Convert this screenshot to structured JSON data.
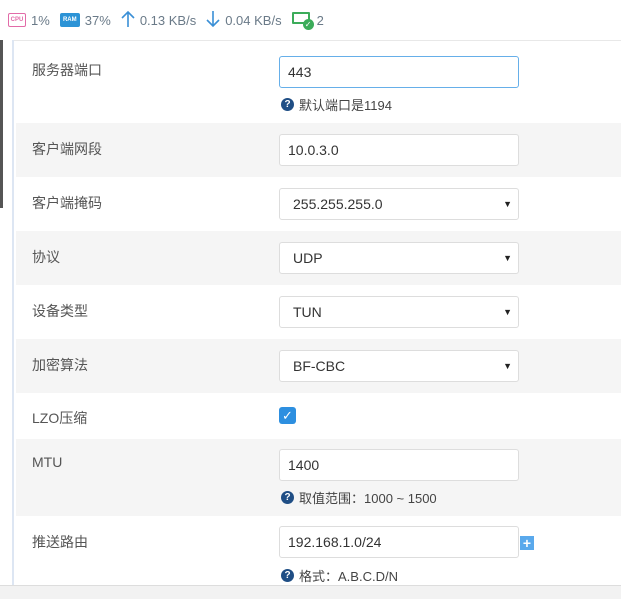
{
  "status": {
    "cpu_icon": "CPU",
    "cpu": "1%",
    "ram_icon": "RAM",
    "ram": "37%",
    "up_icon": "arrow-up-icon",
    "upload": "0.13 KB/s",
    "down_icon": "arrow-down-icon",
    "download": "0.04 KB/s",
    "devices": "2"
  },
  "form": {
    "server_port": {
      "label": "服务器端口",
      "value": "443",
      "hint": "默认端口是1194"
    },
    "client_subnet": {
      "label": "客户端网段",
      "value": "10.0.3.0"
    },
    "client_mask": {
      "label": "客户端掩码",
      "value": "255.255.255.0"
    },
    "protocol": {
      "label": "协议",
      "value": "UDP"
    },
    "device_type": {
      "label": "设备类型",
      "value": "TUN"
    },
    "cipher": {
      "label": "加密算法",
      "value": "BF-CBC"
    },
    "lzo": {
      "label": "LZO压缩",
      "checked": true
    },
    "mtu": {
      "label": "MTU",
      "value": "1400",
      "hint": "取值范围：1000 ~ 1500"
    },
    "push_route": {
      "label": "推送路由",
      "value": "192.168.1.0/24",
      "hint": "格式：A.B.C.D/N"
    }
  },
  "colors": {
    "accent": "#2d8fe0",
    "focus": "#66afe9",
    "ok": "#3cac5a",
    "hint_icon": "#1f4e85"
  }
}
